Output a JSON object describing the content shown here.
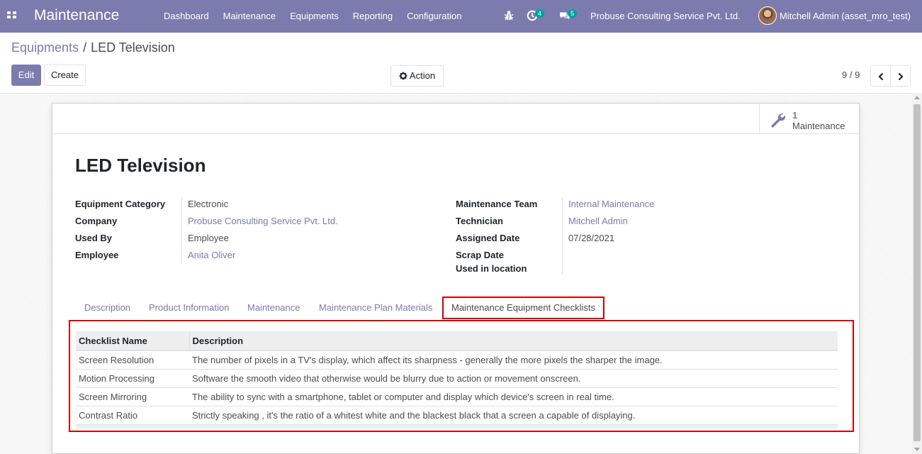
{
  "navbar": {
    "brand": "Maintenance",
    "menu": [
      "Dashboard",
      "Maintenance",
      "Equipments",
      "Reporting",
      "Configuration"
    ],
    "activity_count": "4",
    "message_count": "5",
    "company": "Probuse Consulting Service Pvt. Ltd.",
    "user": "Mitchell Admin (asset_mro_test)"
  },
  "breadcrumb": {
    "parent": "Equipments",
    "separator": "/",
    "current": "LED Television"
  },
  "controls": {
    "edit": "Edit",
    "create": "Create",
    "action": "Action",
    "pager": "9 / 9"
  },
  "stat_button": {
    "value": "1",
    "label": "Maintenance"
  },
  "record": {
    "title": "LED Television",
    "left_fields": [
      {
        "label": "Equipment Category",
        "value": "Electronic"
      },
      {
        "label": "Company",
        "value": "Probuse Consulting Service Pvt. Ltd."
      },
      {
        "label": "Used By",
        "value": "Employee"
      },
      {
        "label": "Employee",
        "value": "Anita Oliver"
      }
    ],
    "right_fields": [
      {
        "label": "Maintenance Team",
        "value": "Internal Maintenance"
      },
      {
        "label": "Technician",
        "value": "Mitchell Admin"
      },
      {
        "label": "Assigned Date",
        "value": "07/28/2021"
      },
      {
        "label": "Scrap Date",
        "value": ""
      },
      {
        "label": "Used in location",
        "value": ""
      }
    ]
  },
  "tabs": [
    "Description",
    "Product Information",
    "Maintenance",
    "Maintenance Plan Materials",
    "Maintenance Equipment Checklists"
  ],
  "active_tab": "Maintenance Equipment Checklists",
  "checklist": {
    "columns": [
      "Checklist Name",
      "Description"
    ],
    "rows": [
      [
        "Screen Resolution",
        "The number of pixels in a TV's display, which affect its sharpness - generally the more pixels the sharper the image."
      ],
      [
        "Motion Processing",
        "Software the smooth video that otherwise would be blurry due to action or movement onscreen."
      ],
      [
        "Screen Mirroring",
        "The ability to sync with a smartphone, tablet or computer and display which device's screen in real time."
      ],
      [
        "Contrast Ratio",
        "Strictly speaking , it's the ratio of a whitest white and the blackest black that a screen a capable of displaying."
      ]
    ]
  },
  "colors": {
    "primary": "#7c7bad",
    "badge": "#00a09d",
    "highlight": "#d40000"
  }
}
